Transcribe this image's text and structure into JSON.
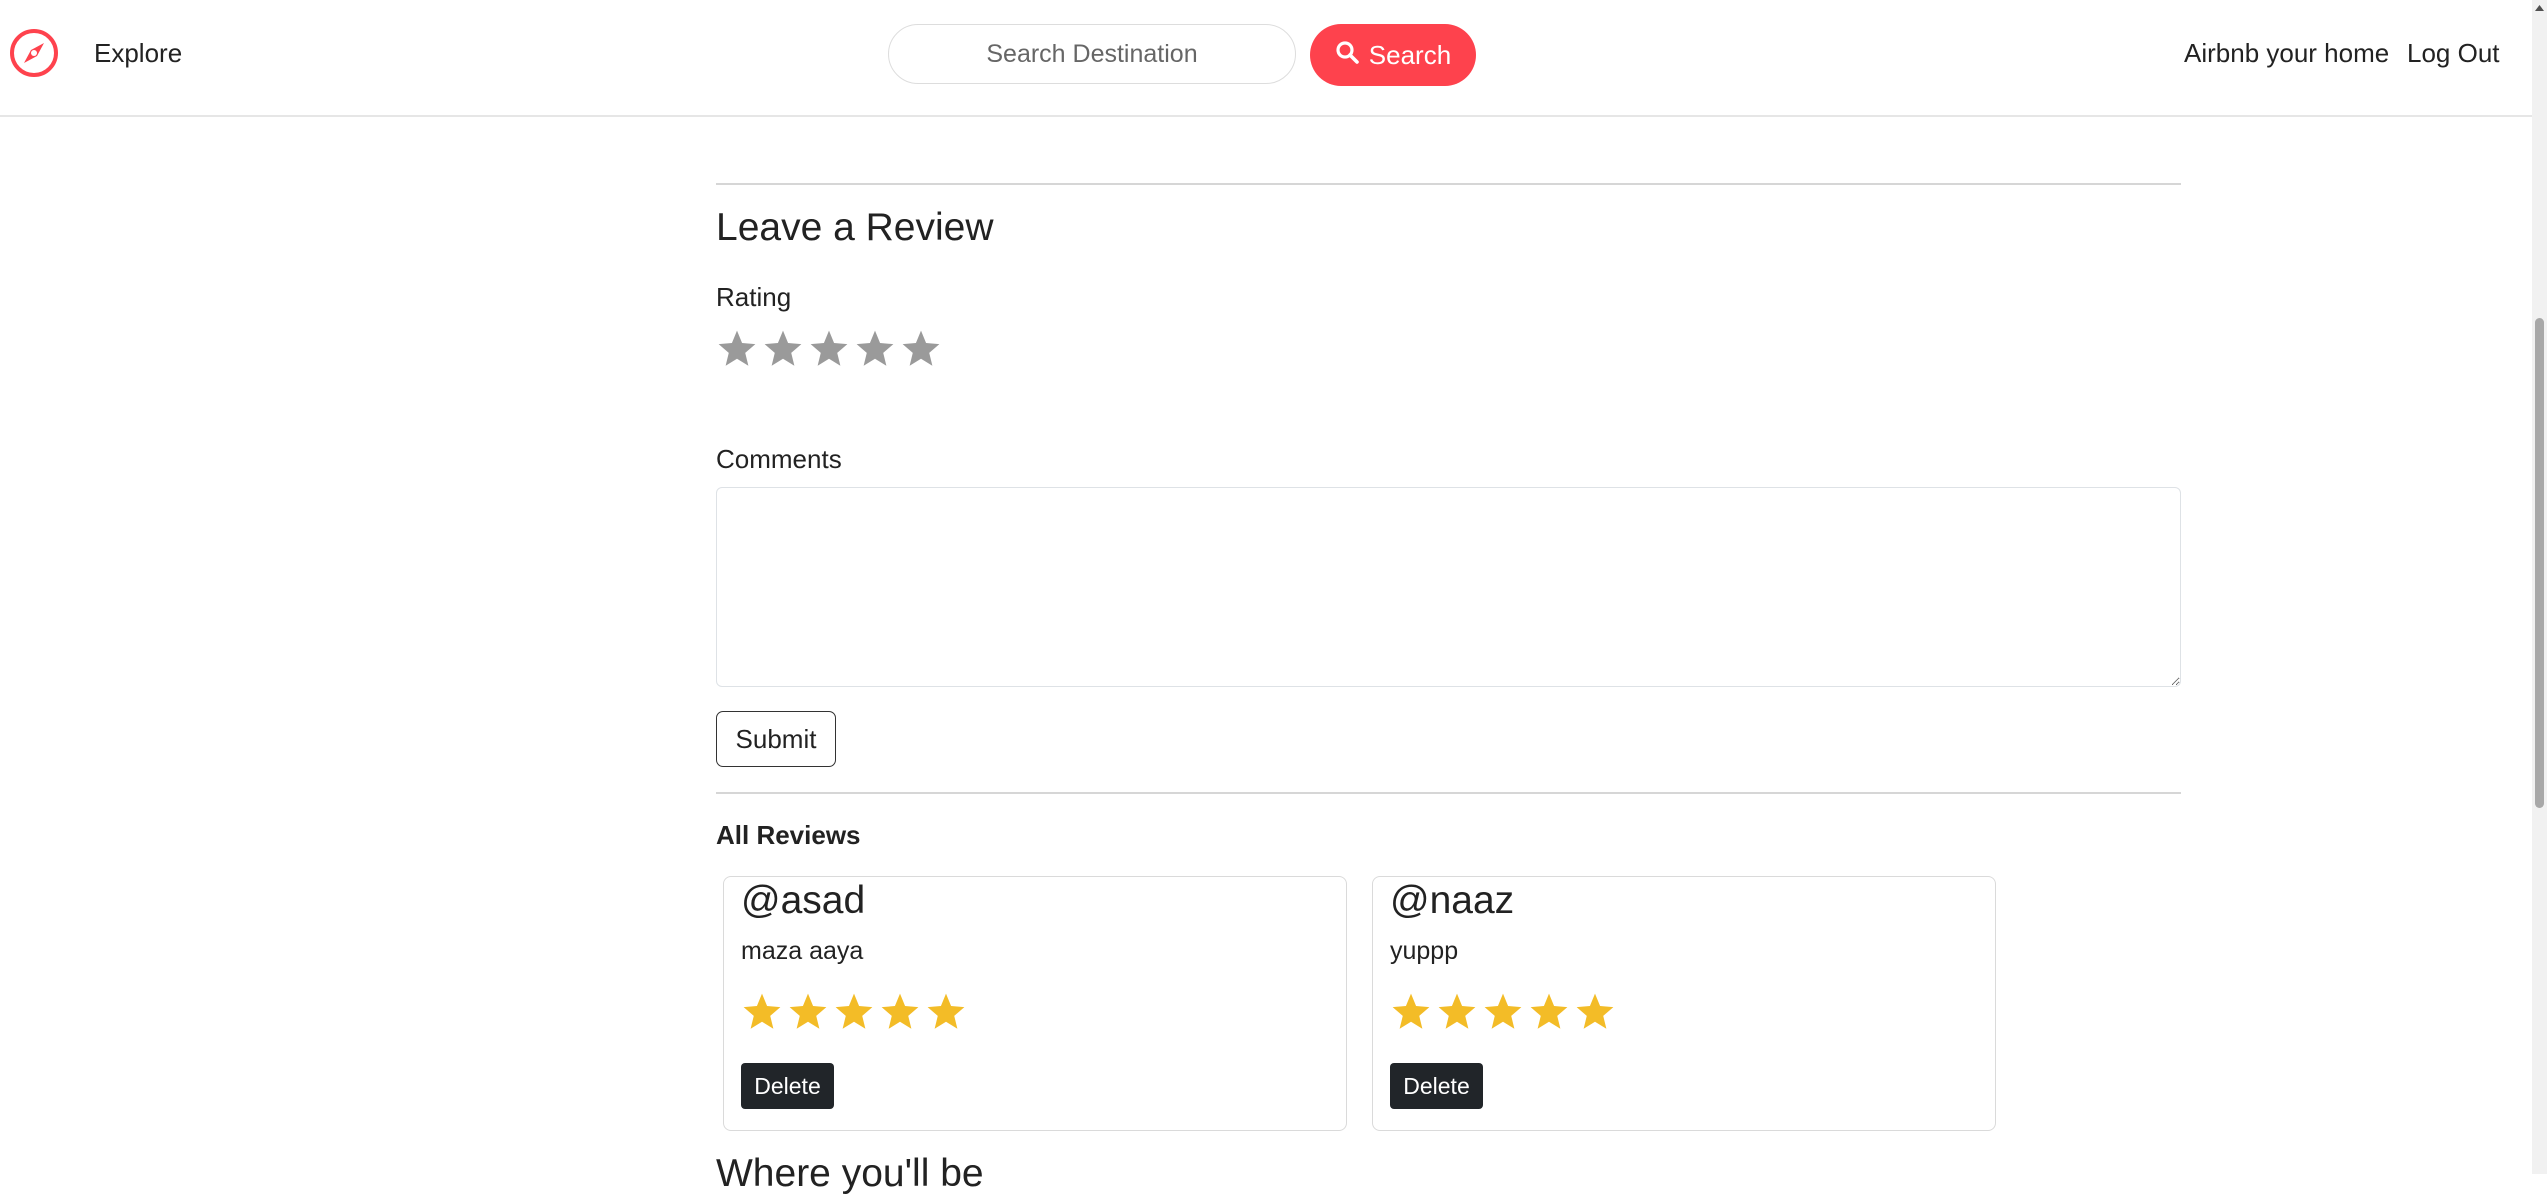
{
  "nav": {
    "explore": "Explore",
    "search_placeholder": "Search Destination",
    "search_button": "Search",
    "host_link": "Airbnb your home",
    "logout": "Log Out"
  },
  "review_form": {
    "title": "Leave a Review",
    "rating_label": "Rating",
    "rating_value": 0,
    "rating_max": 5,
    "comments_label": "Comments",
    "comments_value": "",
    "submit": "Submit"
  },
  "reviews": {
    "heading": "All Reviews",
    "items": [
      {
        "user": "@asad",
        "comment": "maza aaya",
        "rating": 5,
        "delete": "Delete"
      },
      {
        "user": "@naaz",
        "comment": "yuppp",
        "rating": 5,
        "delete": "Delete"
      }
    ]
  },
  "next_section_heading": "Where you'll be",
  "colors": {
    "brand": "#fe424d",
    "star_filled": "#f3bc27",
    "star_empty": "#9a9a9a",
    "delete_button": "#212529"
  },
  "icons": {
    "brand": "compass-icon",
    "search": "magnifying-glass-icon",
    "star": "star-icon"
  }
}
